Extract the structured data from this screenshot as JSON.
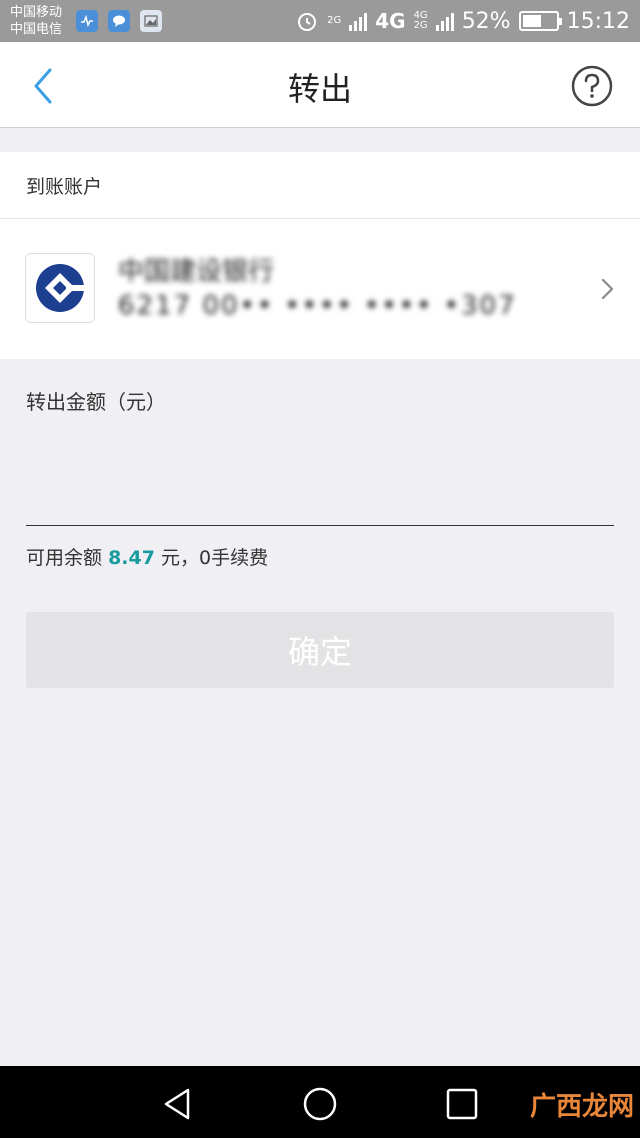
{
  "status_bar": {
    "carrier_1": "中国移动",
    "carrier_2": "中国电信",
    "network_1": "2G",
    "network_2": "4G",
    "network_3_top": "4G",
    "network_3_bottom": "2G",
    "battery_percent": "52%",
    "time": "15:12"
  },
  "header": {
    "title": "转出"
  },
  "account_section": {
    "label": "到账账户",
    "bank_name": "中国建设银行",
    "account_number": "6217 00•• •••• •••• •307"
  },
  "amount": {
    "label": "转出金额（元）",
    "input_value": "",
    "balance_prefix": "可用余额",
    "balance_value": "8.47",
    "balance_suffix": "元，0手续费"
  },
  "confirm_button": {
    "label": "确定"
  },
  "watermark": "广西龙网",
  "colors": {
    "accent": "#1a9ba0",
    "back_arrow": "#3aa0e6",
    "bank_logo": "#1c3f8f"
  }
}
